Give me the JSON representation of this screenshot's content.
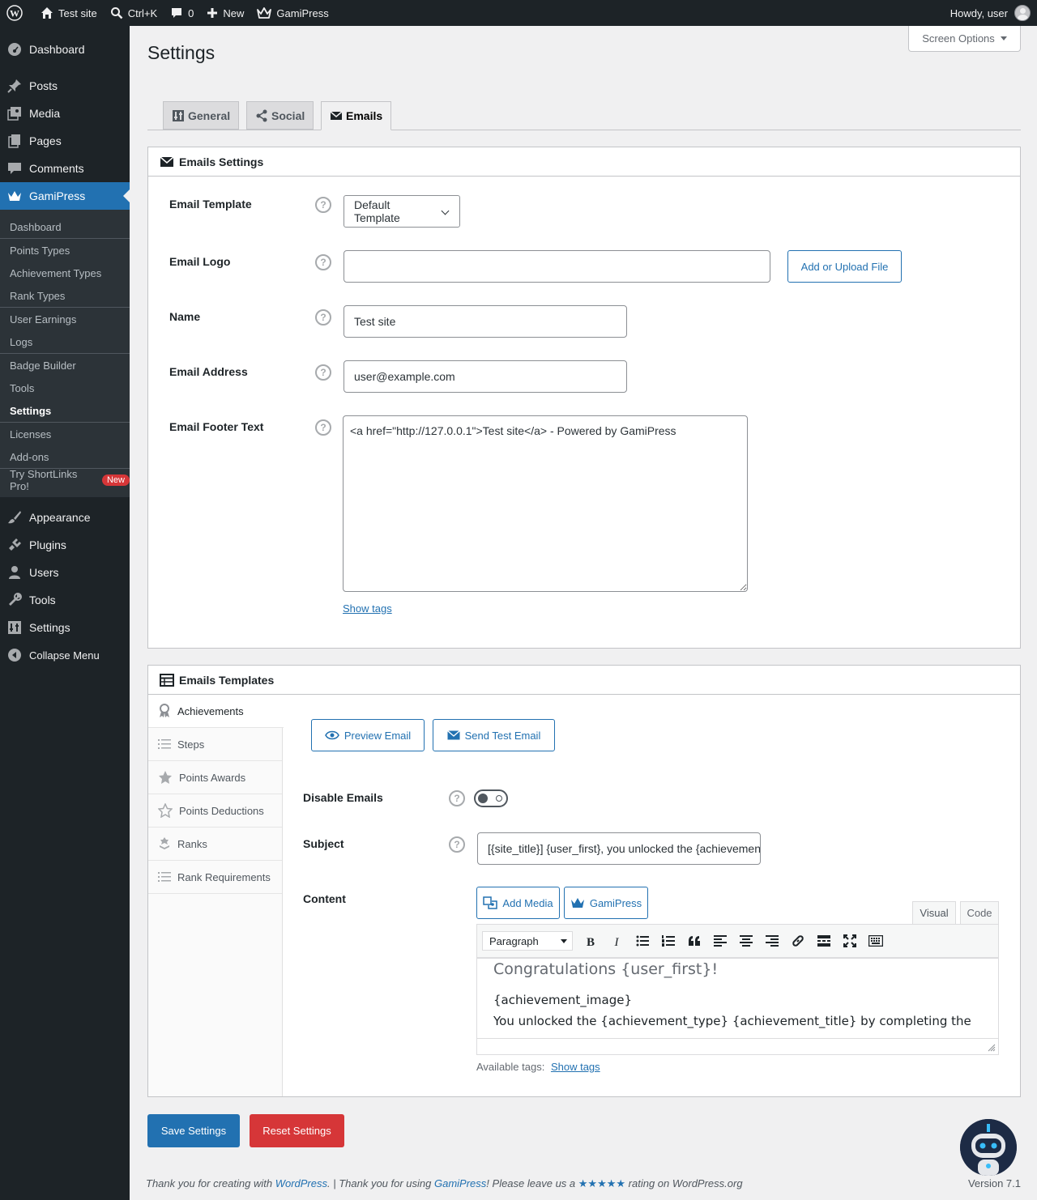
{
  "adminbar": {
    "site_name": "Test site",
    "search_shortcut": "Ctrl+K",
    "comments_count": "0",
    "new_label": "New",
    "plugin_label": "GamiPress",
    "howdy": "Howdy, user"
  },
  "sidebar": {
    "items": [
      {
        "label": "Dashboard",
        "icon": "dashboard-icon"
      },
      {
        "label": "Posts",
        "icon": "pin-icon"
      },
      {
        "label": "Media",
        "icon": "media-icon"
      },
      {
        "label": "Pages",
        "icon": "pages-icon"
      },
      {
        "label": "Comments",
        "icon": "comment-icon"
      },
      {
        "label": "GamiPress",
        "icon": "crown-icon"
      },
      {
        "label": "Appearance",
        "icon": "brush-icon"
      },
      {
        "label": "Plugins",
        "icon": "plugin-icon"
      },
      {
        "label": "Users",
        "icon": "user-icon"
      },
      {
        "label": "Tools",
        "icon": "wrench-icon"
      },
      {
        "label": "Settings",
        "icon": "settings-icon"
      },
      {
        "label": "Collapse Menu",
        "icon": "collapse-icon"
      }
    ],
    "submenu": [
      "Dashboard",
      "Points Types",
      "Achievement Types",
      "Rank Types",
      "User Earnings",
      "Logs",
      "Badge Builder",
      "Tools",
      "Settings",
      "Licenses",
      "Add-ons",
      "Try ShortLinks Pro!"
    ],
    "new_badge": "New"
  },
  "page": {
    "title": "Settings",
    "screen_options": "Screen Options",
    "tabs": [
      "General",
      "Social",
      "Emails"
    ]
  },
  "emails_settings": {
    "title": "Emails Settings",
    "template_label": "Email Template",
    "template_value": "Default Template",
    "logo_label": "Email Logo",
    "logo_value": "",
    "upload_button": "Add or Upload File",
    "name_label": "Name",
    "name_value": "Test site",
    "address_label": "Email Address",
    "address_value": "user@example.com",
    "footer_label": "Email Footer Text",
    "footer_value": "<a href=\"http://127.0.0.1\">Test site</a> - Powered by GamiPress",
    "show_tags": "Show tags",
    "help": "?"
  },
  "emails_templates": {
    "title": "Emails Templates",
    "tabs": [
      "Achievements",
      "Steps",
      "Points Awards",
      "Points Deductions",
      "Ranks",
      "Rank Requirements"
    ],
    "preview_button": "Preview Email",
    "send_test_button": "Send Test Email",
    "disable_label": "Disable Emails",
    "disable_value": false,
    "subject_label": "Subject",
    "subject_value": "[{site_title}] {user_first}, you unlocked the {achievement_title}",
    "content_label": "Content",
    "add_media": "Add Media",
    "gamipress_button": "GamiPress",
    "editor_tabs": [
      "Visual",
      "Code"
    ],
    "format_select": "Paragraph",
    "content_heading": "Congratulations {user_first}!",
    "content_line1": "{achievement_image}",
    "content_line2": "You unlocked the {achievement_type} {achievement_title} by completing the",
    "available_tags": "Available tags:",
    "show_tags": "Show tags"
  },
  "actions": {
    "save": "Save Settings",
    "reset": "Reset Settings"
  },
  "footer": {
    "thanks_prefix": "Thank you for creating with ",
    "wordpress": "WordPress",
    "middle": ". | Thank you for using ",
    "gamipress": "GamiPress",
    "after": "! Please leave us a ",
    "stars": "★★★★★",
    "suffix": " rating on WordPress.org",
    "version": "Version 7.1"
  },
  "colors": {
    "accent": "#2271b1",
    "danger": "#d63638",
    "adminbar": "#1d2327"
  }
}
